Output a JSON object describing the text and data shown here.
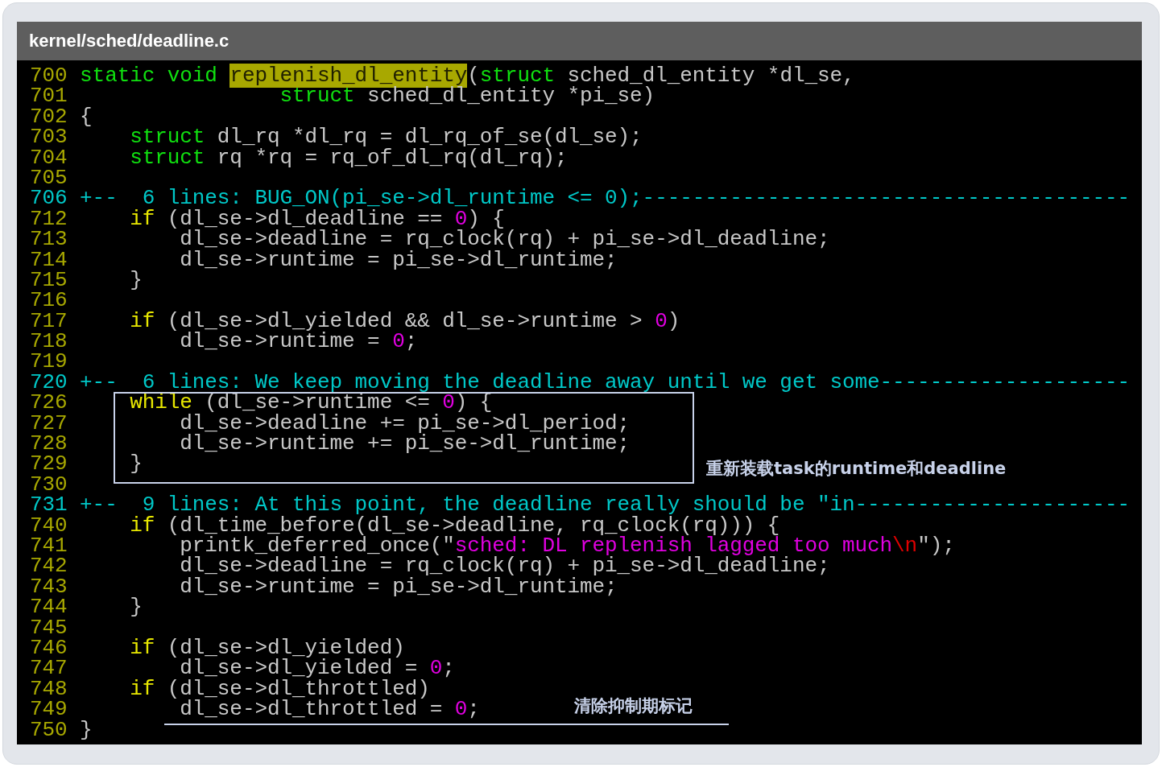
{
  "window": {
    "title": "kernel/sched/deadline.c"
  },
  "code_lines": [
    {
      "number": "700",
      "kind": "code",
      "segments": [
        {
          "text": "static void ",
          "kind": "keyword"
        },
        {
          "text": "replenish_dl_entity",
          "kind": "match"
        },
        {
          "text": "(",
          "kind": "plain"
        },
        {
          "text": "struct",
          "kind": "keyword"
        },
        {
          "text": " sched_dl_entity *dl_se,",
          "kind": "plain"
        }
      ]
    },
    {
      "number": "701",
      "kind": "code",
      "segments": [
        {
          "text": "                struct",
          "kind": "keyword"
        },
        {
          "text": " sched_dl_entity *pi_se)",
          "kind": "plain"
        }
      ]
    },
    {
      "number": "702",
      "kind": "code",
      "segments": [
        {
          "text": "{",
          "kind": "plain"
        }
      ]
    },
    {
      "number": "703",
      "kind": "code",
      "segments": [
        {
          "text": "    struct",
          "kind": "keyword"
        },
        {
          "text": " dl_rq *dl_rq = dl_rq_of_se(dl_se);",
          "kind": "plain"
        }
      ]
    },
    {
      "number": "704",
      "kind": "code",
      "segments": [
        {
          "text": "    struct",
          "kind": "keyword"
        },
        {
          "text": " rq *rq = rq_of_dl_rq(dl_rq);",
          "kind": "plain"
        }
      ]
    },
    {
      "number": "705",
      "kind": "blank"
    },
    {
      "number": "706",
      "kind": "fold",
      "text": "+--  6 lines: BUG_ON(pi_se->dl_runtime <= 0);---------------------------------------"
    },
    {
      "number": "712",
      "kind": "code",
      "segments": [
        {
          "text": "    if",
          "kind": "control"
        },
        {
          "text": " (dl_se->dl_deadline == ",
          "kind": "plain"
        },
        {
          "text": "0",
          "kind": "number"
        },
        {
          "text": ") {",
          "kind": "plain"
        }
      ]
    },
    {
      "number": "713",
      "kind": "code",
      "segments": [
        {
          "text": "        dl_se->deadline = rq_clock(rq) + pi_se->dl_deadline;",
          "kind": "plain"
        }
      ]
    },
    {
      "number": "714",
      "kind": "code",
      "segments": [
        {
          "text": "        dl_se->runtime = pi_se->dl_runtime;",
          "kind": "plain"
        }
      ]
    },
    {
      "number": "715",
      "kind": "code",
      "segments": [
        {
          "text": "    }",
          "kind": "plain"
        }
      ]
    },
    {
      "number": "716",
      "kind": "blank"
    },
    {
      "number": "717",
      "kind": "code",
      "segments": [
        {
          "text": "    if",
          "kind": "control"
        },
        {
          "text": " (dl_se->dl_yielded && dl_se->runtime > ",
          "kind": "plain"
        },
        {
          "text": "0",
          "kind": "number"
        },
        {
          "text": ")",
          "kind": "plain"
        }
      ]
    },
    {
      "number": "718",
      "kind": "code",
      "segments": [
        {
          "text": "        dl_se->runtime = ",
          "kind": "plain"
        },
        {
          "text": "0",
          "kind": "number"
        },
        {
          "text": ";",
          "kind": "plain"
        }
      ]
    },
    {
      "number": "719",
      "kind": "blank"
    },
    {
      "number": "720",
      "kind": "fold",
      "text": "+--  6 lines: We keep moving the deadline away until we get some--------------------"
    },
    {
      "number": "726",
      "kind": "code",
      "segments": [
        {
          "text": "    while",
          "kind": "control"
        },
        {
          "text": " (dl_se->runtime <= ",
          "kind": "plain"
        },
        {
          "text": "0",
          "kind": "number"
        },
        {
          "text": ") {",
          "kind": "plain"
        }
      ]
    },
    {
      "number": "727",
      "kind": "code",
      "segments": [
        {
          "text": "        dl_se->deadline += pi_se->dl_period;",
          "kind": "plain"
        }
      ]
    },
    {
      "number": "728",
      "kind": "code",
      "segments": [
        {
          "text": "        dl_se->runtime += pi_se->dl_runtime;",
          "kind": "plain"
        }
      ]
    },
    {
      "number": "729",
      "kind": "code",
      "segments": [
        {
          "text": "    }",
          "kind": "plain"
        }
      ]
    },
    {
      "number": "730",
      "kind": "blank"
    },
    {
      "number": "731",
      "kind": "fold",
      "text": "+--  9 lines: At this point, the deadline really should be \"in----------------------"
    },
    {
      "number": "740",
      "kind": "code",
      "segments": [
        {
          "text": "    if",
          "kind": "control"
        },
        {
          "text": " (dl_time_before(dl_se->deadline, rq_clock(rq))) {",
          "kind": "plain"
        }
      ]
    },
    {
      "number": "741",
      "kind": "code",
      "segments": [
        {
          "text": "        printk_deferred_once(\"",
          "kind": "plain"
        },
        {
          "text": "sched: DL replenish lagged too much",
          "kind": "string"
        },
        {
          "text": "\\n",
          "kind": "escape"
        },
        {
          "text": "\");",
          "kind": "plain"
        }
      ]
    },
    {
      "number": "742",
      "kind": "code",
      "segments": [
        {
          "text": "        dl_se->deadline = rq_clock(rq) + pi_se->dl_deadline;",
          "kind": "plain"
        }
      ]
    },
    {
      "number": "743",
      "kind": "code",
      "segments": [
        {
          "text": "        dl_se->runtime = pi_se->dl_runtime;",
          "kind": "plain"
        }
      ]
    },
    {
      "number": "744",
      "kind": "code",
      "segments": [
        {
          "text": "    }",
          "kind": "plain"
        }
      ]
    },
    {
      "number": "745",
      "kind": "blank"
    },
    {
      "number": "746",
      "kind": "code",
      "segments": [
        {
          "text": "    if",
          "kind": "control"
        },
        {
          "text": " (dl_se->dl_yielded)",
          "kind": "plain"
        }
      ]
    },
    {
      "number": "747",
      "kind": "code",
      "segments": [
        {
          "text": "        dl_se->dl_yielded = ",
          "kind": "plain"
        },
        {
          "text": "0",
          "kind": "number"
        },
        {
          "text": ";",
          "kind": "plain"
        }
      ]
    },
    {
      "number": "748",
      "kind": "code",
      "segments": [
        {
          "text": "    if",
          "kind": "control"
        },
        {
          "text": " (dl_se->dl_throttled)",
          "kind": "plain"
        }
      ]
    },
    {
      "number": "749",
      "kind": "code",
      "segments": [
        {
          "text": "        dl_se->dl_throttled = ",
          "kind": "plain"
        },
        {
          "text": "0",
          "kind": "number"
        },
        {
          "text": ";",
          "kind": "plain"
        }
      ]
    },
    {
      "number": "750",
      "kind": "code",
      "segments": [
        {
          "text": "}",
          "kind": "plain"
        }
      ]
    }
  ],
  "annotations": [
    {
      "kind": "box",
      "text": "重新装载task的runtime和deadline"
    },
    {
      "kind": "underline",
      "text": "清除抑制期标记"
    }
  ]
}
